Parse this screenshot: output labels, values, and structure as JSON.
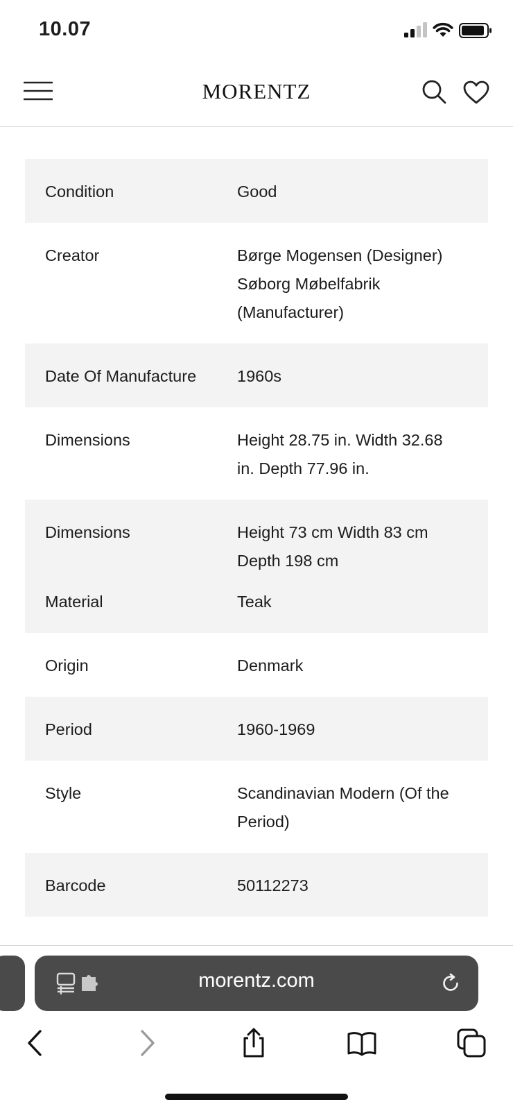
{
  "status_bar": {
    "time": "10.07",
    "icons": [
      "cellular-signal-icon",
      "wifi-icon",
      "battery-icon"
    ]
  },
  "header": {
    "brand": "MORENTZ",
    "icons": [
      "hamburger-menu-icon",
      "search-icon",
      "heart-icon"
    ]
  },
  "specs": [
    {
      "label": "Condition",
      "value": "Good"
    },
    {
      "label": "Creator",
      "value": "Børge Mogensen (Designer) Søborg Møbelfabrik (Manufacturer)"
    },
    {
      "label": "Date Of Manufacture",
      "value": "1960s"
    },
    {
      "label": "Dimensions",
      "value": "Height 28.75 in. Width 32.68 in. Depth 77.96 in."
    },
    {
      "label": "Dimensions",
      "value": "Height 73 cm Width 83 cm Depth 198 cm"
    },
    {
      "label": "Material",
      "value": "Teak"
    },
    {
      "label": "Origin",
      "value": "Denmark"
    },
    {
      "label": "Period",
      "value": "1960-1969"
    },
    {
      "label": "Style",
      "value": "Scandinavian Modern (Of the Period)"
    },
    {
      "label": "Barcode",
      "value": "50112273"
    }
  ],
  "browser": {
    "url": "morentz.com",
    "toolbar": [
      "back-icon",
      "forward-icon",
      "share-icon",
      "bookmarks-icon",
      "tabs-icon"
    ]
  },
  "colors": {
    "row_shade": "#f3f3f3",
    "url_bar": "#4a4a4a",
    "text": "#1c1c1c",
    "forward_disabled": "#9a9a9a"
  }
}
